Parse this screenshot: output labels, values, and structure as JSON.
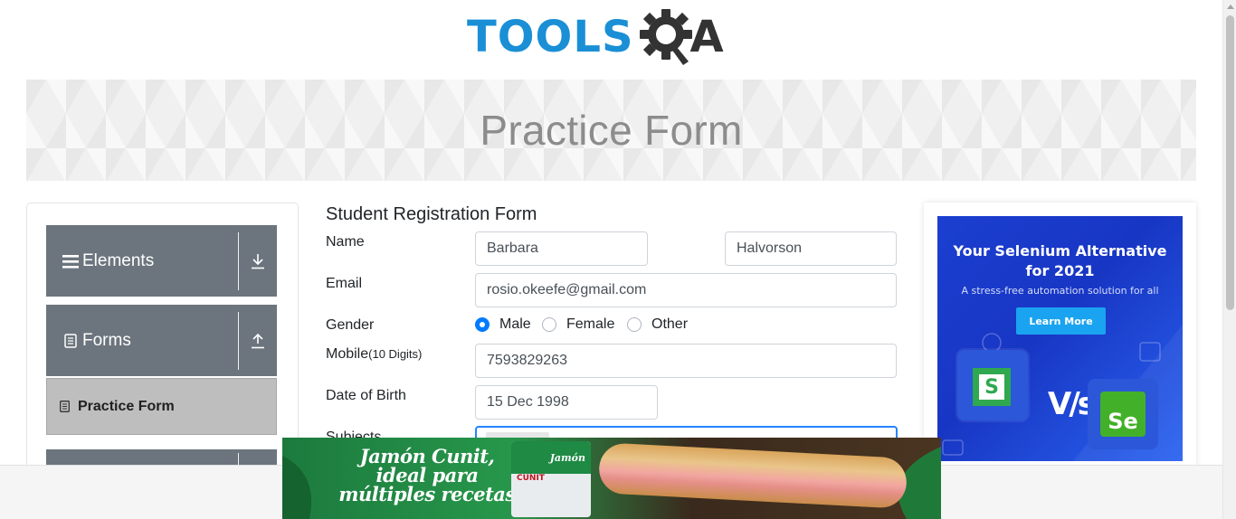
{
  "logo": {
    "text": "TOOLS",
    "accent": "A",
    "colors": {
      "tools": "#1a8fd6",
      "qa": "#333333"
    }
  },
  "banner": {
    "title": "Practice Form"
  },
  "sidebar": {
    "groups": [
      {
        "label": "Elements",
        "icon": "menu-lines-icon",
        "toggle_icon": "download-icon"
      },
      {
        "label": "Forms",
        "icon": "form-doc-icon",
        "toggle_icon": "upload-icon"
      }
    ],
    "active_item": {
      "label": "Practice Form",
      "icon": "form-doc-icon"
    }
  },
  "form": {
    "title": "Student Registration Form",
    "name": {
      "label": "Name",
      "first": "Barbara",
      "last": "Halvorson"
    },
    "email": {
      "label": "Email",
      "value": "rosio.okeefe@gmail.com"
    },
    "gender": {
      "label": "Gender",
      "options": [
        "Male",
        "Female",
        "Other"
      ],
      "selected": "Male"
    },
    "mobile": {
      "label": "Mobile",
      "hint": "(10 Digits)",
      "value": "7593829263"
    },
    "dob": {
      "label": "Date of Birth",
      "value": "15 Dec 1998"
    },
    "subjects": {
      "label": "Subjects"
    }
  },
  "right_ad": {
    "title_line1": "Your Selenium Alternative",
    "title_line2": "for 2021",
    "subtitle": "A stress-free automation solution for all",
    "button": "Learn More",
    "vs": "V/s",
    "tile_left": "S",
    "tile_right": "Se"
  },
  "bottom_ad": {
    "line1": "Jamón Cunit,",
    "line2": "ideal para",
    "line3": "múltiples recetas",
    "pack_label": "Jamón",
    "pack_brand": "CUNIT"
  },
  "colors": {
    "accent": "#007bff",
    "sidebar_group": "#6c757d",
    "sidebar_active": "#bebebe",
    "focus": "#2684ff"
  }
}
